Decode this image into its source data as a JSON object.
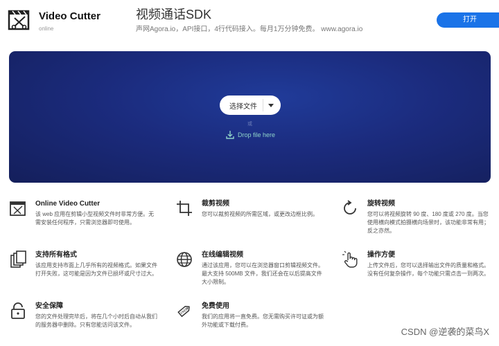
{
  "header": {
    "app_title": "Video Cutter",
    "app_subtitle": "online",
    "logo_icon": "film-scissors-icon"
  },
  "ad": {
    "title": "视频通话SDK",
    "description": "声网Agora.io，API接口，4行代码接入。每月1万分钟免费。 www.agora.io",
    "button_label": "打开"
  },
  "hero": {
    "select_label": "选择文件",
    "or_label": "或",
    "drop_label": "Drop file here",
    "drop_icon": "download-icon",
    "colors": {
      "background": "#1b2b7d",
      "drop_text": "#8fd3c9"
    }
  },
  "features": [
    {
      "icon": "film-scissors-icon",
      "title": "Online Video Cutter",
      "desc": "该 web 应用在剪辑小型视频文件时非常方便。无需安装任何程序，只需浏览器即可使用。"
    },
    {
      "icon": "crop-icon",
      "title": "裁剪视频",
      "desc": "您可以裁剪视频的所需区域，或更改边框比例。"
    },
    {
      "icon": "rotate-icon",
      "title": "旋转视频",
      "desc": "您可以将视频旋转 90 度、180 度或 270 度。当您使用横向模式拍摄横向场景时，该功能非常有用；反之亦然。"
    },
    {
      "icon": "documents-icon",
      "title": "支持所有格式",
      "desc": "该应用支持市面上几乎所有的视频格式。如果文件打开失败，这可能是因为文件已损坏或尺寸过大。"
    },
    {
      "icon": "globe-icon",
      "title": "在线编辑视频",
      "desc": "通过该应用，您可以在浏览器窗口剪辑视频文件。最大支持 500MB 文件，我们还会在以后提高文件大小限制。"
    },
    {
      "icon": "hand-pointer-icon",
      "title": "操作方便",
      "desc": "上传文件后，您可以选择输出文件的质量和格式。没有任何复杂操作，每个功能只需点击一到两次。"
    },
    {
      "icon": "lock-icon",
      "title": "安全保障",
      "desc": "您的文件处理完毕后，将在几个小时后自动从我们的服务器中删除。只有您能访问该文件。"
    },
    {
      "icon": "free-tag-icon",
      "title": "免费使用",
      "desc": "我们的应用将一直免费。您无需购买许可证或为额外功能或下载付费。"
    }
  ],
  "watermark": "CSDN @逆袭的菜鸟X"
}
